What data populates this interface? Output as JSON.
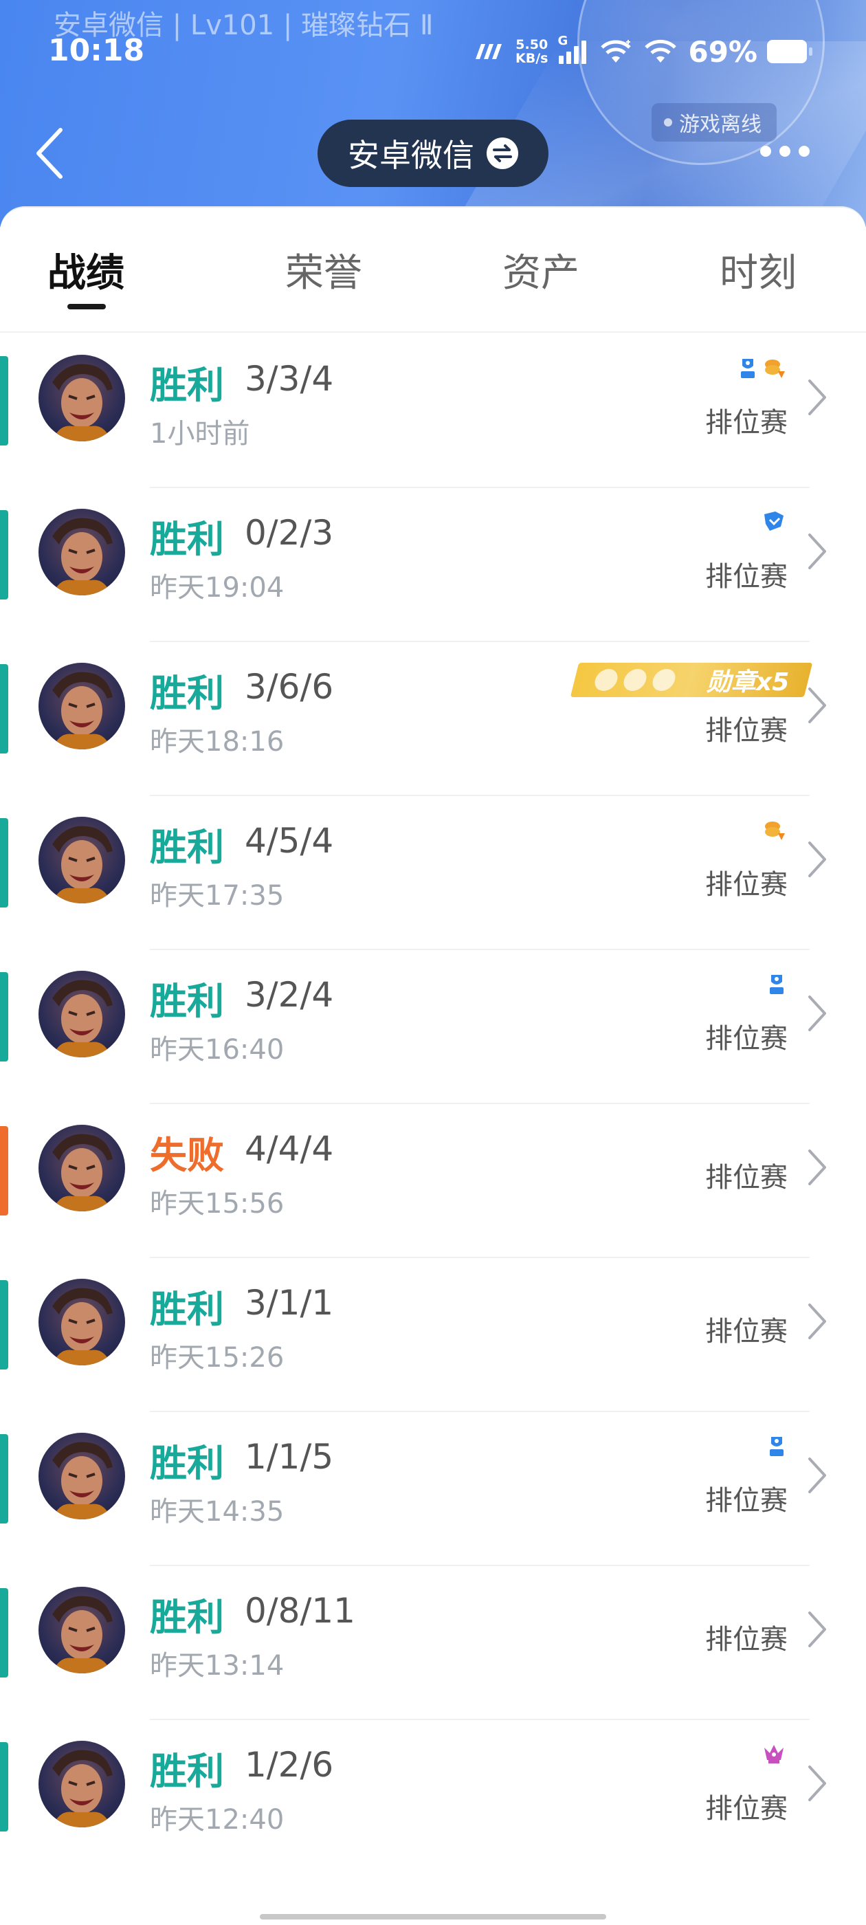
{
  "status_bar": {
    "subtitle": "安卓微信 | Lv101 | 璀璨钻石 Ⅱ",
    "time": "10:18",
    "net_speed_value": "5.50",
    "net_speed_unit": "KB/s",
    "network_type": "G",
    "battery": "69%"
  },
  "header": {
    "game_status": "游戏离线",
    "account_name": "安卓微信"
  },
  "tabs": [
    {
      "label": "战绩",
      "active": true
    },
    {
      "label": "荣誉",
      "active": false
    },
    {
      "label": "资产",
      "active": false
    },
    {
      "label": "时刻",
      "active": false
    }
  ],
  "matches": [
    {
      "result": "胜利",
      "outcome": "win",
      "kda": "3/3/4",
      "time": "1小时前",
      "mode": "排位赛",
      "badges": [
        "mvp-blue-icon",
        "gold-coin-icon"
      ]
    },
    {
      "result": "胜利",
      "outcome": "win",
      "kda": "0/2/3",
      "time": "昨天19:04",
      "mode": "排位赛",
      "badges": [
        "blue-shield-icon"
      ]
    },
    {
      "result": "胜利",
      "outcome": "win",
      "kda": "3/6/6",
      "time": "昨天18:16",
      "mode": "排位赛",
      "badges": [
        "medal-banner"
      ],
      "medal_text": "勋章x5"
    },
    {
      "result": "胜利",
      "outcome": "win",
      "kda": "4/5/4",
      "time": "昨天17:35",
      "mode": "排位赛",
      "badges": [
        "gold-coin-icon"
      ]
    },
    {
      "result": "胜利",
      "outcome": "win",
      "kda": "3/2/4",
      "time": "昨天16:40",
      "mode": "排位赛",
      "badges": [
        "mvp-blue-icon"
      ]
    },
    {
      "result": "失败",
      "outcome": "loss",
      "kda": "4/4/4",
      "time": "昨天15:56",
      "mode": "排位赛",
      "badges": []
    },
    {
      "result": "胜利",
      "outcome": "win",
      "kda": "3/1/1",
      "time": "昨天15:26",
      "mode": "排位赛",
      "badges": []
    },
    {
      "result": "胜利",
      "outcome": "win",
      "kda": "1/1/5",
      "time": "昨天14:35",
      "mode": "排位赛",
      "badges": [
        "mvp-blue-icon"
      ]
    },
    {
      "result": "胜利",
      "outcome": "win",
      "kda": "0/8/11",
      "time": "昨天13:14",
      "mode": "排位赛",
      "badges": []
    },
    {
      "result": "胜利",
      "outcome": "win",
      "kda": "1/2/6",
      "time": "昨天12:40",
      "mode": "排位赛",
      "badges": [
        "purple-crown-icon"
      ]
    }
  ],
  "colors": {
    "win": "#17a99a",
    "loss": "#ee6d2d",
    "header_blue": "#4a86f0",
    "pill_bg": "#22344f"
  }
}
